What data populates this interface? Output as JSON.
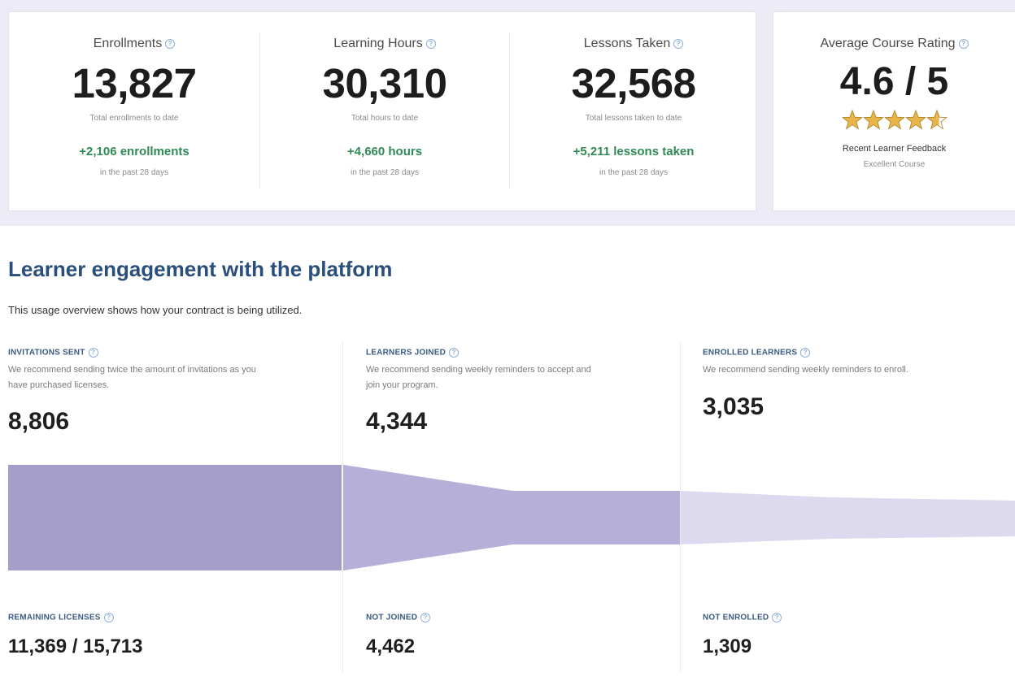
{
  "stats": [
    {
      "label": "Enrollments",
      "value": "13,827",
      "sub": "Total enrollments to date",
      "delta": "+2,106 enrollments",
      "period": "in the past 28 days"
    },
    {
      "label": "Learning Hours",
      "value": "30,310",
      "sub": "Total hours to date",
      "delta": "+4,660 hours",
      "period": "in the past 28 days"
    },
    {
      "label": "Lessons Taken",
      "value": "32,568",
      "sub": "Total lessons taken to date",
      "delta": "+5,211 lessons taken",
      "period": "in the past 28 days"
    }
  ],
  "rating": {
    "label": "Average Course Rating",
    "value": "4.6 / 5",
    "stars": 4.6,
    "feedback_title": "Recent Learner Feedback",
    "feedback_text": "Excellent Course"
  },
  "engagement": {
    "title": "Learner engagement with the platform",
    "description": "This usage overview shows how your contract is being utilized.",
    "columns": [
      {
        "label": "INVITATIONS SENT",
        "desc_line1": "We recommend sending twice the amount of invitations as you",
        "desc_line2": "have purchased licenses.",
        "value": "8,806",
        "bottom_label": "REMAINING LICENSES",
        "bottom_value": "11,369 / 15,713"
      },
      {
        "label": "LEARNERS JOINED",
        "desc_line1": "We recommend sending weekly reminders to accept and",
        "desc_line2": "join your program.",
        "value": "4,344",
        "bottom_label": "NOT JOINED",
        "bottom_value": "4,462"
      },
      {
        "label": "ENROLLED LEARNERS",
        "desc_line1": "We recommend sending weekly reminders to enroll.",
        "desc_line2": "",
        "value": "3,035",
        "bottom_label": "NOT ENROLLED",
        "bottom_value": "1,309"
      }
    ]
  },
  "colors": {
    "funnel_1": "#a49ec9",
    "funnel_2": "#b6b0d9",
    "funnel_3": "#ddd9ee",
    "accent_green": "#2f8a55",
    "heading_blue": "#2a4f7a",
    "star_gold": "#e8b54a"
  },
  "icons": {
    "info": "info-circle-icon",
    "star": "star-icon"
  }
}
